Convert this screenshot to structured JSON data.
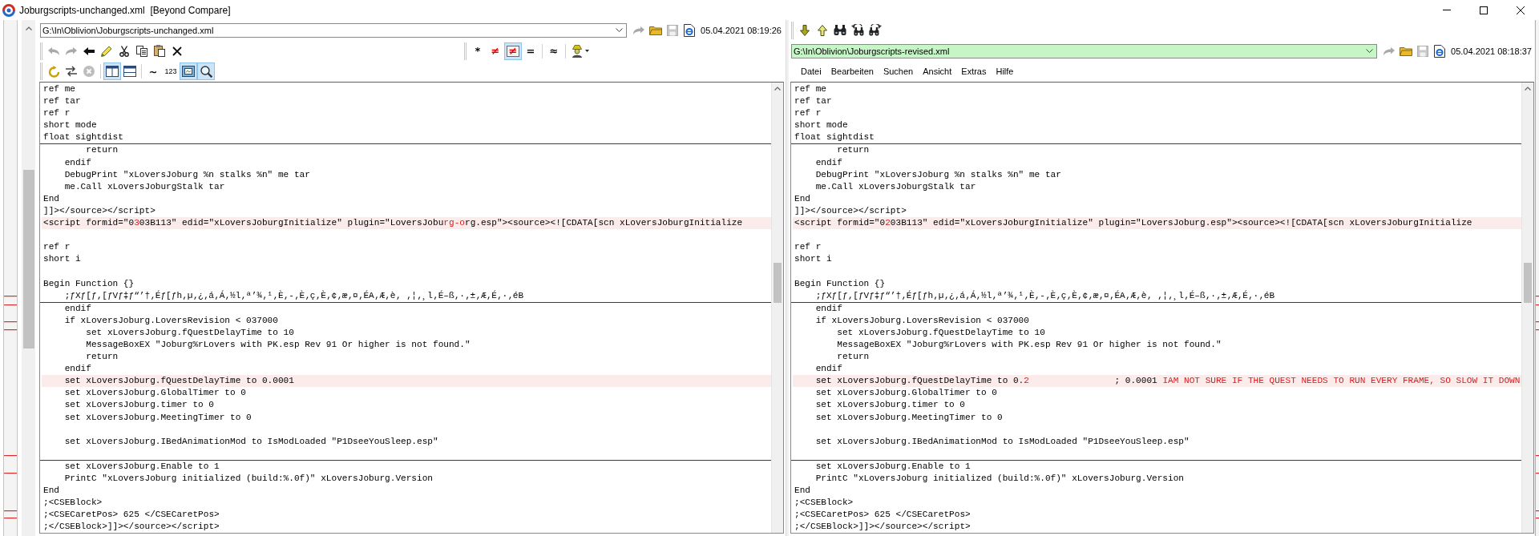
{
  "window": {
    "title": "Joburgscripts-unchanged.xml  [Beyond Compare]"
  },
  "panes": [
    {
      "header": [
        {
          "kind": "path",
          "path": "G:\\In\\Oblivion\\Joburgscripts-unchanged.xml",
          "highlighted": false,
          "buttons": [
            {
              "kind": "redo",
              "disabled": true
            },
            {
              "kind": "folder",
              "disabled": false
            },
            {
              "kind": "save",
              "disabled": true
            },
            {
              "kind": "web",
              "disabled": false
            }
          ],
          "date": "05.04.2021 08:19:26"
        },
        {
          "kind": "toolbar",
          "bands": [
            {
              "groups": [
                [
                  {
                    "kind": "undo",
                    "disabled": true,
                    "selected": false
                  },
                  {
                    "kind": "redo",
                    "disabled": true,
                    "selected": false
                  },
                  {
                    "kind": "back",
                    "disabled": false,
                    "selected": false
                  },
                  {
                    "kind": "pencil",
                    "disabled": false,
                    "selected": false
                  },
                  {
                    "kind": "scissors",
                    "disabled": false,
                    "selected": false
                  },
                  {
                    "kind": "copy",
                    "disabled": false,
                    "selected": false
                  },
                  {
                    "kind": "paste",
                    "disabled": false,
                    "selected": false
                  },
                  {
                    "kind": "cross",
                    "disabled": false,
                    "selected": false
                  }
                ]
              ]
            },
            {
              "groups": [
                [
                  {
                    "kind": "text",
                    "label": "*",
                    "disabled": false,
                    "selected": false
                  },
                  {
                    "kind": "text",
                    "label": "≠",
                    "color": "#e00000",
                    "disabled": false,
                    "selected": false
                  },
                  {
                    "kind": "framed",
                    "label": "≠",
                    "color": "#e00000",
                    "disabled": false,
                    "selected": true
                  },
                  {
                    "kind": "text",
                    "label": "=",
                    "disabled": false,
                    "selected": false
                  }
                ],
                [
                  {
                    "kind": "text",
                    "label": "≈",
                    "disabled": false,
                    "selected": false
                  }
                ],
                [
                  {
                    "kind": "profile",
                    "disabled": false,
                    "selected": false
                  }
                ]
              ]
            }
          ]
        },
        {
          "kind": "toolbar",
          "bands": [
            {
              "groups": [
                [
                  {
                    "kind": "swirl",
                    "disabled": false,
                    "selected": false
                  },
                  {
                    "kind": "swap",
                    "disabled": false,
                    "selected": false
                  },
                  {
                    "kind": "stop",
                    "disabled": true,
                    "selected": false
                  }
                ],
                [
                  {
                    "kind": "columns",
                    "disabled": false,
                    "selected": true
                  },
                  {
                    "kind": "rows",
                    "disabled": false,
                    "selected": false
                  }
                ],
                [
                  {
                    "kind": "text",
                    "label": "~",
                    "disabled": false,
                    "selected": false
                  },
                  {
                    "kind": "text",
                    "label": "123",
                    "disabled": false,
                    "selected": false
                  },
                  {
                    "kind": "frame",
                    "disabled": false,
                    "selected": true
                  },
                  {
                    "kind": "zoom",
                    "disabled": false,
                    "selected": true
                  }
                ]
              ]
            }
          ]
        }
      ],
      "sections": [
        {
          "lines": [
            {
              "text": "ref me",
              "differs": false
            },
            {
              "text": "ref tar",
              "differs": false
            },
            {
              "text": "ref r",
              "differs": false
            },
            {
              "text": "short mode",
              "differs": false
            },
            {
              "text": "float sightdist",
              "differs": false
            }
          ]
        },
        {
          "lines": [
            {
              "text": "        return",
              "differs": false
            },
            {
              "text": "    endif",
              "differs": false
            },
            {
              "text": "    DebugPrint \"xLoversJoburg %n stalks %n\" me tar",
              "differs": false
            },
            {
              "text": "    me.Call xLoversJoburgStalk tar",
              "differs": false
            },
            {
              "text": "End",
              "differs": false
            },
            {
              "text": "]]></source></script>",
              "differs": false
            },
            {
              "differs": true,
              "segments": [
                {
                  "text": "<script formid=\"0",
                  "changed": false
                },
                {
                  "text": "3",
                  "changed": true
                },
                {
                  "text": "03B113\" edid=\"xLoversJoburgInitialize\" plugin=\"LoversJobu",
                  "changed": false
                },
                {
                  "text": "rg-o",
                  "changed": true
                },
                {
                  "text": "rg.esp\"><source><![CDATA[scn xLoversJoburgInitialize",
                  "changed": false
                }
              ]
            },
            {
              "differs": false
            },
            {
              "text": "ref r",
              "differs": false
            },
            {
              "text": "short i",
              "differs": false
            },
            {
              "differs": false
            },
            {
              "text": "Begin Function {}",
              "differs": false
            },
            {
              "text": "    ;ƒXƒ[ƒ‚[ƒVƒ‡ƒ“’†‚Éƒ[ƒh‚µ‚¿‚á‚Á‚½l‚ª’¾‚¹‚È‚-‚È‚ç‚È‚¢‚æ‚¤‚ÉA‚Æ‚è‚ ‚¦‚¸l‚É–ß‚·‚±‚Æ‚É‚·‚éB",
              "differs": false
            }
          ]
        },
        {
          "lines": [
            {
              "text": "    endif",
              "differs": false
            },
            {
              "text": "    if xLoversJoburg.LoversRevision < 037000",
              "differs": false
            },
            {
              "text": "        set xLoversJoburg.fQuestDelayTime to 10",
              "differs": false
            },
            {
              "text": "        MessageBoxEX \"Joburg%rLovers with PK.esp Rev 91 Or higher is not found.\"",
              "differs": false
            },
            {
              "text": "        return",
              "differs": false
            },
            {
              "text": "    endif",
              "differs": false
            },
            {
              "differs": true,
              "segments": [
                {
                  "text": "    set xLoversJoburg.fQuestDelayTime to 0.0001",
                  "changed": false
                }
              ]
            },
            {
              "text": "    set xLoversJoburg.GlobalTimer to 0",
              "differs": false
            },
            {
              "text": "    set xLoversJoburg.timer to 0",
              "differs": false
            },
            {
              "text": "    set xLoversJoburg.MeetingTimer to 0",
              "differs": false
            },
            {
              "differs": false
            },
            {
              "text": "    set xLoversJoburg.IBedAnimationMod to IsModLoaded \"P1DseeYouSleep.esp\"",
              "differs": false
            },
            {
              "differs": false
            }
          ]
        },
        {
          "lines": [
            {
              "text": "    set xLoversJoburg.Enable to 1",
              "differs": false
            },
            {
              "text": "    PrintC \"xLoversJoburg initialized (build:%.0f)\" xLoversJoburg.Version",
              "differs": false
            },
            {
              "text": "End",
              "differs": false
            },
            {
              "text": ";<CSEBlock>",
              "differs": false
            },
            {
              "text": ";<CSECaretPos> 625 </CSECaretPos>",
              "differs": false
            },
            {
              "text": ";</CSEBlock>]]></source></script>",
              "differs": false
            }
          ]
        }
      ]
    },
    {
      "header": [
        {
          "kind": "toolbar",
          "bands": [
            {
              "groups": [
                [
                  {
                    "kind": "down"
                  },
                  {
                    "kind": "up"
                  },
                  {
                    "kind": "find"
                  },
                  {
                    "kind": "findprev"
                  },
                  {
                    "kind": "findnext"
                  }
                ]
              ]
            }
          ]
        },
        {
          "kind": "path",
          "path": "G:\\In\\Oblivion\\Joburgscripts-revised.xml",
          "highlighted": true,
          "buttons": [
            {
              "kind": "redo",
              "disabled": true
            },
            {
              "kind": "folder",
              "disabled": false
            },
            {
              "kind": "save",
              "disabled": true
            },
            {
              "kind": "web",
              "disabled": false
            }
          ],
          "date": "05.04.2021 08:18:37"
        },
        {
          "kind": "menu",
          "items": [
            "Datei",
            "Bearbeiten",
            "Suchen",
            "Ansicht",
            "Extras",
            "Hilfe"
          ]
        }
      ],
      "sections": [
        {
          "lines": [
            {
              "text": "ref me",
              "differs": false
            },
            {
              "text": "ref tar",
              "differs": false
            },
            {
              "text": "ref r",
              "differs": false
            },
            {
              "text": "short mode",
              "differs": false
            },
            {
              "text": "float sightdist",
              "differs": false
            }
          ]
        },
        {
          "lines": [
            {
              "text": "        return",
              "differs": false
            },
            {
              "text": "    endif",
              "differs": false
            },
            {
              "text": "    DebugPrint \"xLoversJoburg %n stalks %n\" me tar",
              "differs": false
            },
            {
              "text": "    me.Call xLoversJoburgStalk tar",
              "differs": false
            },
            {
              "text": "End",
              "differs": false
            },
            {
              "text": "]]></source></script>",
              "differs": false
            },
            {
              "differs": true,
              "segments": [
                {
                  "text": "<script formid=\"0",
                  "changed": false
                },
                {
                  "text": "2",
                  "changed": true
                },
                {
                  "text": "03B113\" edid=\"xLoversJoburgInitialize\" plugin=\"LoversJoburg.esp\"><source><![CDATA[scn xLoversJoburgInitialize",
                  "changed": false
                }
              ]
            },
            {
              "differs": false
            },
            {
              "text": "ref r",
              "differs": false
            },
            {
              "text": "short i",
              "differs": false
            },
            {
              "differs": false
            },
            {
              "text": "Begin Function {}",
              "differs": false
            },
            {
              "text": "    ;ƒXƒ[ƒ‚[ƒVƒ‡ƒ“’†‚Éƒ[ƒh‚µ‚¿‚á‚Á‚½l‚ª’¾‚¹‚È‚-‚È‚ç‚È‚¢‚æ‚¤‚ÉA‚Æ‚è‚ ‚¦‚¸l‚É–ß‚·‚±‚Æ‚É‚·‚éB",
              "differs": false
            }
          ]
        },
        {
          "lines": [
            {
              "text": "    endif",
              "differs": false
            },
            {
              "text": "    if xLoversJoburg.LoversRevision < 037000",
              "differs": false
            },
            {
              "text": "        set xLoversJoburg.fQuestDelayTime to 10",
              "differs": false
            },
            {
              "text": "        MessageBoxEX \"Joburg%rLovers with PK.esp Rev 91 Or higher is not found.\"",
              "differs": false
            },
            {
              "text": "        return",
              "differs": false
            },
            {
              "text": "    endif",
              "differs": false
            },
            {
              "differs": true,
              "segments": [
                {
                  "text": "    set xLoversJoburg.fQuestDelayTime to 0.",
                  "changed": false
                },
                {
                  "text": "2",
                  "changed": true
                },
                {
                  "text": "                ; 0.0001 ",
                  "changed": false
                },
                {
                  "text": "IAM NOT SURE IF THE QUEST NEEDS TO RUN EVERY FRAME, SO SLOW IT DOWN",
                  "changed": true
                }
              ]
            },
            {
              "text": "    set xLoversJoburg.GlobalTimer to 0",
              "differs": false
            },
            {
              "text": "    set xLoversJoburg.timer to 0",
              "differs": false
            },
            {
              "text": "    set xLoversJoburg.MeetingTimer to 0",
              "differs": false
            },
            {
              "differs": false
            },
            {
              "text": "    set xLoversJoburg.IBedAnimationMod to IsModLoaded \"P1DseeYouSleep.esp\"",
              "differs": false
            },
            {
              "differs": false
            }
          ]
        },
        {
          "lines": [
            {
              "text": "    set xLoversJoburg.Enable to 1",
              "differs": false
            },
            {
              "text": "    PrintC \"xLoversJoburg initialized (build:%.0f)\" xLoversJoburg.Version",
              "differs": false
            },
            {
              "text": "End",
              "differs": false
            },
            {
              "text": ";<CSEBlock>",
              "differs": false
            },
            {
              "text": ";<CSECaretPos> 625 </CSECaretPos>",
              "differs": false
            },
            {
              "text": ";</CSEBlock>]]></source></script>",
              "differs": false
            }
          ]
        }
      ]
    }
  ]
}
